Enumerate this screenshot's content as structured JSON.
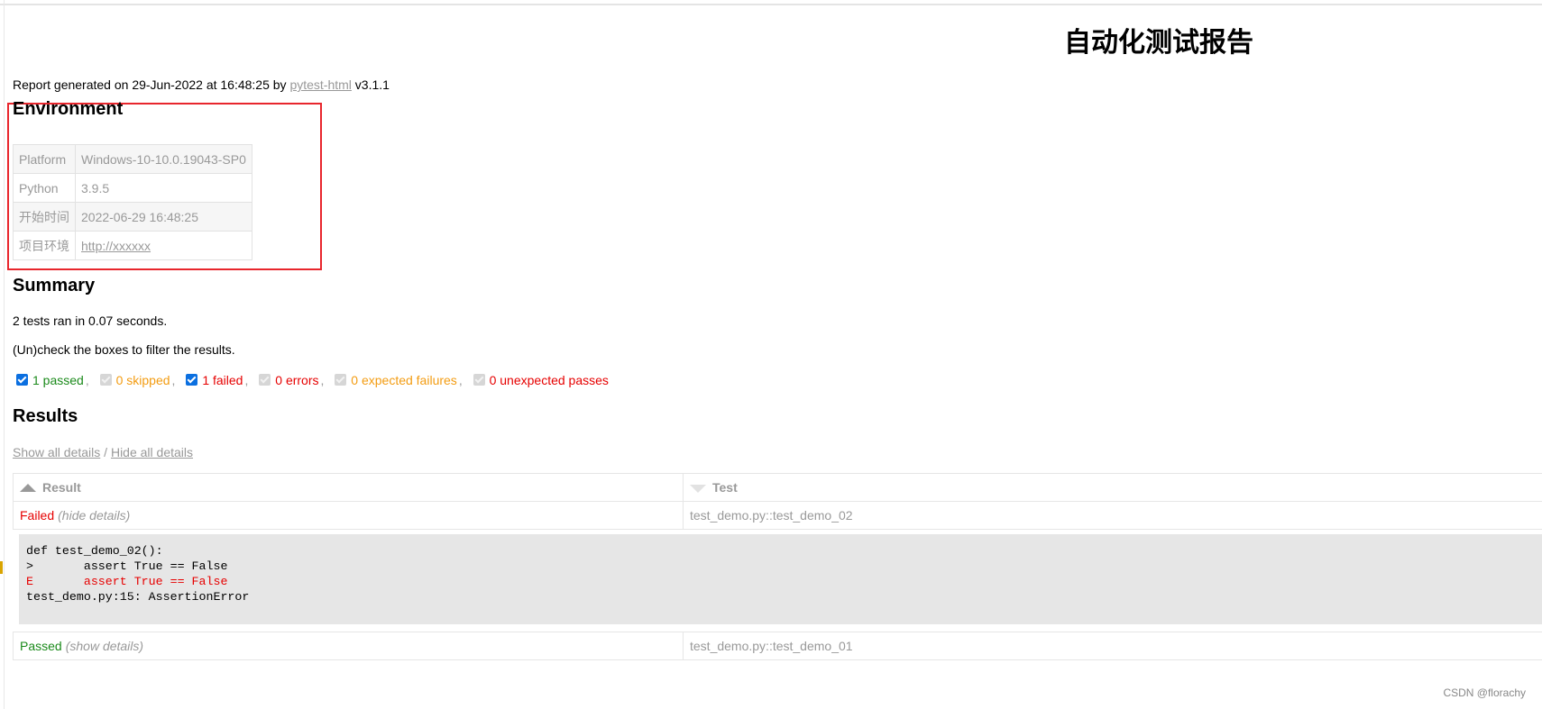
{
  "title": "自动化测试报告",
  "generated": {
    "prefix": "Report generated on 29-Jun-2022 at 16:48:25 by ",
    "link": "pytest-html",
    "suffix": " v3.1.1"
  },
  "environment": {
    "heading": "Environment",
    "rows": [
      {
        "key": "Platform",
        "value": "Windows-10-10.0.19043-SP0"
      },
      {
        "key": "Python",
        "value": "3.9.5"
      },
      {
        "key": "开始时间",
        "value": "2022-06-29 16:48:25"
      },
      {
        "key": "项目环境",
        "value": "http://xxxxxx"
      }
    ]
  },
  "summary": {
    "heading": "Summary",
    "ran": "2 tests ran in 0.07 seconds.",
    "hint": "(Un)check the boxes to filter the results.",
    "filters": [
      {
        "label": "1 passed",
        "checked": true,
        "enabled": true
      },
      {
        "label": "0 skipped",
        "checked": true,
        "enabled": false
      },
      {
        "label": "1 failed",
        "checked": true,
        "enabled": true
      },
      {
        "label": "0 errors",
        "checked": true,
        "enabled": false
      },
      {
        "label": "0 expected failures",
        "checked": true,
        "enabled": false
      },
      {
        "label": "0 unexpected passes",
        "checked": true,
        "enabled": false
      }
    ],
    "separator": ","
  },
  "results": {
    "heading": "Results",
    "show_all": "Show all details",
    "divider": "/",
    "hide_all": "Hide all details",
    "columns": {
      "result": "Result",
      "test": "Test"
    },
    "rows": [
      {
        "result": "Failed",
        "toggle": "(hide details)",
        "test": "test_demo.py::test_demo_02",
        "log": [
          "def test_demo_02():",
          ">       assert True == False",
          "E       assert True == False",
          "",
          "test_demo.py:15: AssertionError"
        ]
      },
      {
        "result": "Passed",
        "toggle": "(show details)",
        "test": "test_demo.py::test_demo_01"
      }
    ]
  },
  "watermark": "CSDN @florachy",
  "colors": {
    "passed": "#1b8a1b",
    "failed": "#e60000",
    "skipped": "#f39c12",
    "highlight_box": "#e8262d",
    "checkbox": "#0b6fe0"
  }
}
